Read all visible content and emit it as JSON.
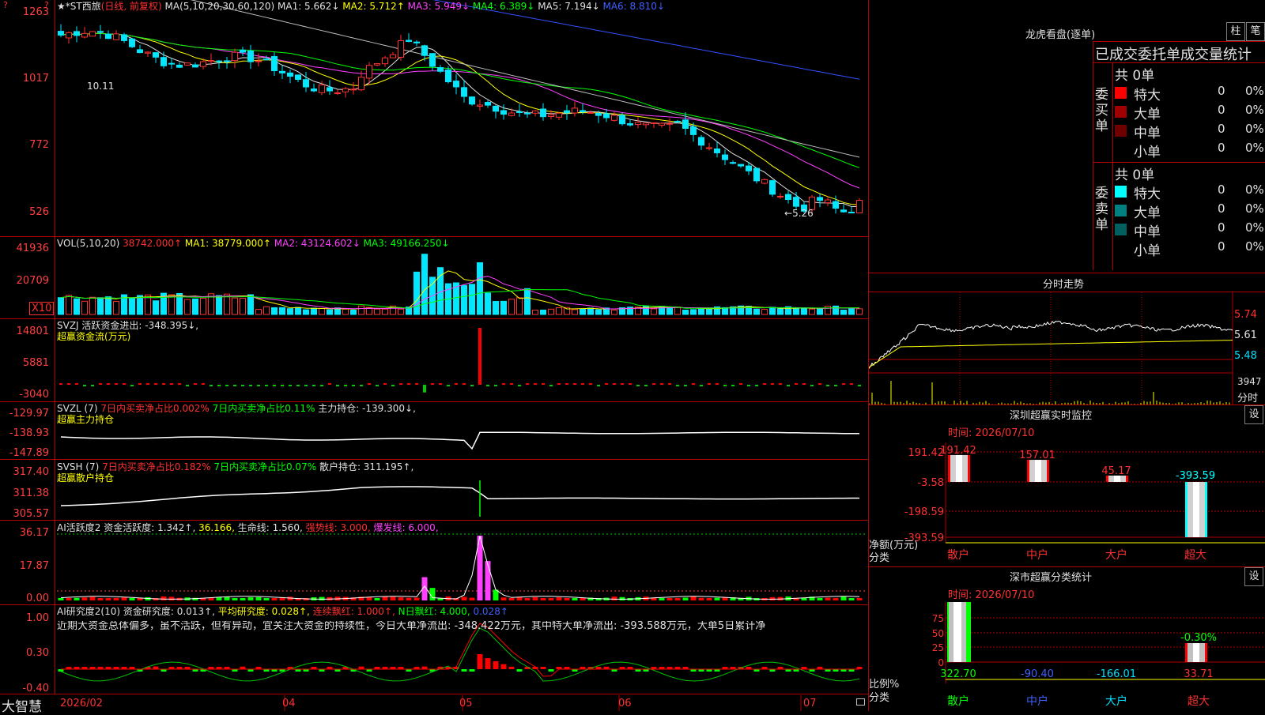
{
  "app": {
    "brand": "大智慧",
    "date_start": "2026/02"
  },
  "main": {
    "title": "★*ST西旅",
    "mode": "(日线, 前复权)",
    "ma_params": "MA(5,10,20,30,60,120)",
    "ma1": "MA1: 5.662↓",
    "ma2": "MA2: 5.712↑",
    "ma3": "MA3: 5.949↓",
    "ma4": "MA4: 6.389↓",
    "ma5": "MA5: 7.194↓",
    "ma6": "MA6: 8.810↓",
    "y_ticks": [
      "1263",
      "1017",
      "772",
      "526"
    ],
    "high_label": "10.11",
    "low_label": "5.26"
  },
  "vol": {
    "params": "VOL(5,10,20)",
    "value": "38742.000↑",
    "ma1": "MA1: 38779.000↑",
    "ma2": "MA2: 43124.602↓",
    "ma3": "MA3: 49166.250↓",
    "y_ticks": [
      "41936",
      "20709"
    ],
    "unit": "X10"
  },
  "svzj": {
    "line1": "SVZJ  活跃资金进出: -348.395↓,",
    "line2": "超赢资金流(万元)",
    "y_ticks": [
      "14801",
      "5881",
      "-3040"
    ]
  },
  "svzl": {
    "name": "SVZL (7)",
    "red": "7日内买卖净占比0.002%",
    "green": "7日内买卖净占比0.11%",
    "white": "主力持仓: -139.300↓,",
    "line2": "超赢主力持仓",
    "y_ticks": [
      "-129.97",
      "-138.93",
      "-147.89"
    ]
  },
  "svsh": {
    "name": "SVSH (7)",
    "red": "7日内买卖净占比0.182%",
    "green": "7日内买卖净占比0.07%",
    "white": "散户持仓: 311.195↑,",
    "line2": "超赢散户持仓",
    "y_ticks": [
      "317.40",
      "311.38",
      "305.57"
    ]
  },
  "ai1": {
    "name": "AI活跃度2",
    "a": "资金活跃度: 1.342↑,",
    "b": "36.166,",
    "c": "生命线: 1.560,",
    "d": "强势线: 3.000,",
    "e": "爆发线: 6.000,",
    "y_ticks": [
      "36.17",
      "17.87",
      "0.00"
    ]
  },
  "ai2": {
    "name": "AI研究度2(10)",
    "a": "资金研究度: 0.013↑,",
    "b": "平均研究度: 0.028↑,",
    "c": "连续飘红: 1.000↑,",
    "d": "N日飘红: 4.000,",
    "e": "0.028↑",
    "comment": "近期大资金总体偏多，虽不活跃，但有异动，宜关注大资金的持续性，今日大单净流出: -348.422万元，其中特大单净流出: -393.588万元，大单5日累计净",
    "y_ticks": [
      "1.00",
      "0.30",
      "-0.40"
    ]
  },
  "x_axis": [
    "04",
    "05",
    "06",
    "07"
  ],
  "panel_lh": {
    "title": "龙虎看盘(逐单)",
    "btn1": "柱",
    "btn2": "笔",
    "subtitle": "已成交委托单成交量统计",
    "buy_label": "委买单",
    "sell_label": "委卖单",
    "buy_total": "共 0单",
    "sell_total": "共 0单",
    "buy_rows": [
      {
        "name": "特大",
        "count": "0",
        "pct": "0%",
        "color": "#ff0000"
      },
      {
        "name": "大单",
        "count": "0",
        "pct": "0%",
        "color": "#a00000"
      },
      {
        "name": "中单",
        "count": "0",
        "pct": "0%",
        "color": "#700000"
      },
      {
        "name": "小单",
        "count": "0",
        "pct": "0%",
        "color": "#000000"
      }
    ],
    "sell_rows": [
      {
        "name": "特大",
        "count": "0",
        "pct": "0%",
        "color": "#00ffff"
      },
      {
        "name": "大单",
        "count": "0",
        "pct": "0%",
        "color": "#008080"
      },
      {
        "name": "中单",
        "count": "0",
        "pct": "0%",
        "color": "#006060"
      },
      {
        "name": "小单",
        "count": "0",
        "pct": "0%",
        "color": "#000000"
      }
    ]
  },
  "panel_fs": {
    "title": "分时走势",
    "y_ticks": [
      "5.74",
      "5.61",
      "5.48"
    ],
    "vol_label": "3947",
    "vol_unit": "分时"
  },
  "panel_sz": {
    "title": "深圳超赢实时监控",
    "btn": "设",
    "time": "时间: 2026/07/10",
    "y_ticks": [
      "191.42",
      "-3.58",
      "-198.59",
      "-393.59"
    ],
    "bar_labels": [
      "191.42",
      "157.01",
      "45.17",
      "-393.59"
    ],
    "axis_label1": "净额(万元)",
    "axis_label2": "分类",
    "cats": [
      "散户",
      "中户",
      "大户",
      "超大"
    ]
  },
  "panel_cls": {
    "title": "深市超赢分类统计",
    "btn": "设",
    "time": "时间: 2026/07/10",
    "y_ticks": [
      "75",
      "50",
      "25",
      "0"
    ],
    "top_label": "-0.30%",
    "values": [
      "322.70",
      "-90.40",
      "-166.01",
      "33.71"
    ],
    "axis_label1": "比例%",
    "axis_label2": "分类",
    "cats": [
      "散户",
      "中户",
      "大户",
      "超大"
    ]
  },
  "colors": {
    "up": "#ff3030",
    "down": "#00e8ff",
    "ma1": "#e0e0e0",
    "ma2": "#ffff00",
    "ma3": "#ff40ff",
    "ma4": "#00ff00",
    "ma5": "#c0c0c0",
    "ma6": "#3050ff"
  }
}
